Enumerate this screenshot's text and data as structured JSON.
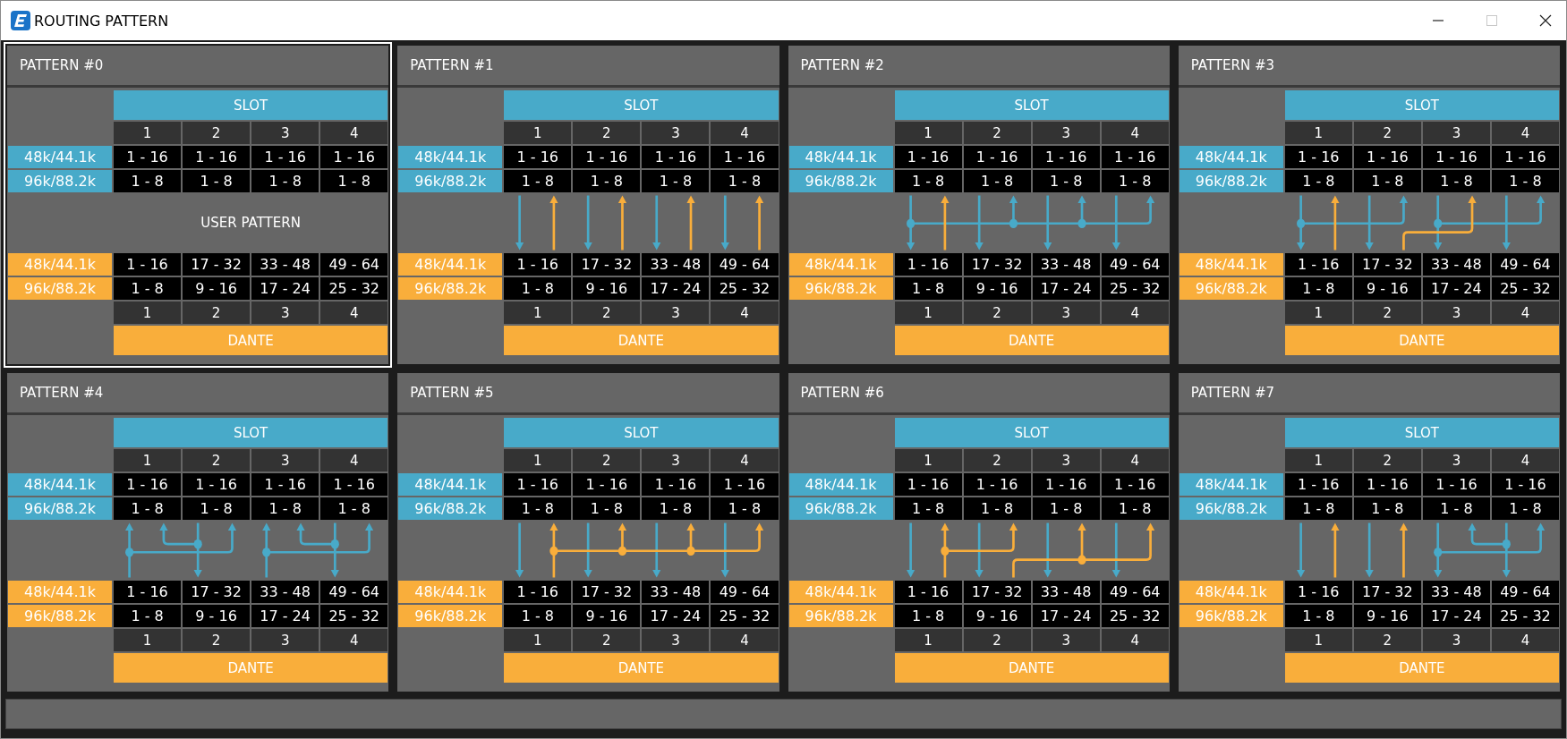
{
  "window": {
    "title": "ROUTING PATTERN",
    "controls": [
      {
        "kind": "minimize",
        "disabled": false
      },
      {
        "kind": "maximize",
        "disabled": true
      },
      {
        "kind": "close",
        "disabled": false
      }
    ]
  },
  "patterns": [
    {
      "title": "PATTERN #0",
      "selected": true,
      "slot": {
        "label": "SLOT",
        "numbers": [
          "1",
          "2",
          "3",
          "4"
        ],
        "rates": [
          {
            "label": "48k/44.1k",
            "ranges": [
              "1 - 16",
              "1 - 16",
              "1 - 16",
              "1 - 16"
            ]
          },
          {
            "label": "96k/88.2k",
            "ranges": [
              "1 - 8",
              "1 - 8",
              "1 - 8",
              "1 - 8"
            ]
          }
        ]
      },
      "user_pattern": "USER PATTERN",
      "dante": {
        "rates": [
          {
            "label": "48k/44.1k",
            "ranges": [
              "1 - 16",
              "17 - 32",
              "33 - 48",
              "49 - 64"
            ]
          },
          {
            "label": "96k/88.2k",
            "ranges": [
              "1 - 8",
              "9 - 16",
              "17 - 24",
              "25 - 32"
            ]
          }
        ],
        "numbers": [
          "1",
          "2",
          "3",
          "4"
        ],
        "label": "DANTE"
      }
    },
    {
      "title": "PATTERN #1",
      "selected": false,
      "slot": {
        "label": "SLOT",
        "numbers": [
          "1",
          "2",
          "3",
          "4"
        ],
        "rates": [
          {
            "label": "48k/44.1k",
            "ranges": [
              "1 - 16",
              "1 - 16",
              "1 - 16",
              "1 - 16"
            ]
          },
          {
            "label": "96k/88.2k",
            "ranges": [
              "1 - 8",
              "1 - 8",
              "1 - 8",
              "1 - 8"
            ]
          }
        ]
      },
      "dante": {
        "rates": [
          {
            "label": "48k/44.1k",
            "ranges": [
              "1 - 16",
              "17 - 32",
              "33 - 48",
              "49 - 64"
            ]
          },
          {
            "label": "96k/88.2k",
            "ranges": [
              "1 - 8",
              "9 - 16",
              "17 - 24",
              "25 - 32"
            ]
          }
        ],
        "numbers": [
          "1",
          "2",
          "3",
          "4"
        ],
        "label": "DANTE"
      }
    },
    {
      "title": "PATTERN #2",
      "selected": false,
      "slot": {
        "label": "SLOT",
        "numbers": [
          "1",
          "2",
          "3",
          "4"
        ],
        "rates": [
          {
            "label": "48k/44.1k",
            "ranges": [
              "1 - 16",
              "1 - 16",
              "1 - 16",
              "1 - 16"
            ]
          },
          {
            "label": "96k/88.2k",
            "ranges": [
              "1 - 8",
              "1 - 8",
              "1 - 8",
              "1 - 8"
            ]
          }
        ]
      },
      "dante": {
        "rates": [
          {
            "label": "48k/44.1k",
            "ranges": [
              "1 - 16",
              "17 - 32",
              "33 - 48",
              "49 - 64"
            ]
          },
          {
            "label": "96k/88.2k",
            "ranges": [
              "1 - 8",
              "9 - 16",
              "17 - 24",
              "25 - 32"
            ]
          }
        ],
        "numbers": [
          "1",
          "2",
          "3",
          "4"
        ],
        "label": "DANTE"
      }
    },
    {
      "title": "PATTERN #3",
      "selected": false,
      "slot": {
        "label": "SLOT",
        "numbers": [
          "1",
          "2",
          "3",
          "4"
        ],
        "rates": [
          {
            "label": "48k/44.1k",
            "ranges": [
              "1 - 16",
              "1 - 16",
              "1 - 16",
              "1 - 16"
            ]
          },
          {
            "label": "96k/88.2k",
            "ranges": [
              "1 - 8",
              "1 - 8",
              "1 - 8",
              "1 - 8"
            ]
          }
        ]
      },
      "dante": {
        "rates": [
          {
            "label": "48k/44.1k",
            "ranges": [
              "1 - 16",
              "17 - 32",
              "33 - 48",
              "49 - 64"
            ]
          },
          {
            "label": "96k/88.2k",
            "ranges": [
              "1 - 8",
              "9 - 16",
              "17 - 24",
              "25 - 32"
            ]
          }
        ],
        "numbers": [
          "1",
          "2",
          "3",
          "4"
        ],
        "label": "DANTE"
      }
    },
    {
      "title": "PATTERN #4",
      "selected": false,
      "slot": {
        "label": "SLOT",
        "numbers": [
          "1",
          "2",
          "3",
          "4"
        ],
        "rates": [
          {
            "label": "48k/44.1k",
            "ranges": [
              "1 - 16",
              "1 - 16",
              "1 - 16",
              "1 - 16"
            ]
          },
          {
            "label": "96k/88.2k",
            "ranges": [
              "1 - 8",
              "1 - 8",
              "1 - 8",
              "1 - 8"
            ]
          }
        ]
      },
      "dante": {
        "rates": [
          {
            "label": "48k/44.1k",
            "ranges": [
              "1 - 16",
              "17 - 32",
              "33 - 48",
              "49 - 64"
            ]
          },
          {
            "label": "96k/88.2k",
            "ranges": [
              "1 - 8",
              "9 - 16",
              "17 - 24",
              "25 - 32"
            ]
          }
        ],
        "numbers": [
          "1",
          "2",
          "3",
          "4"
        ],
        "label": "DANTE"
      }
    },
    {
      "title": "PATTERN #5",
      "selected": false,
      "slot": {
        "label": "SLOT",
        "numbers": [
          "1",
          "2",
          "3",
          "4"
        ],
        "rates": [
          {
            "label": "48k/44.1k",
            "ranges": [
              "1 - 16",
              "1 - 16",
              "1 - 16",
              "1 - 16"
            ]
          },
          {
            "label": "96k/88.2k",
            "ranges": [
              "1 - 8",
              "1 - 8",
              "1 - 8",
              "1 - 8"
            ]
          }
        ]
      },
      "dante": {
        "rates": [
          {
            "label": "48k/44.1k",
            "ranges": [
              "1 - 16",
              "17 - 32",
              "33 - 48",
              "49 - 64"
            ]
          },
          {
            "label": "96k/88.2k",
            "ranges": [
              "1 - 8",
              "9 - 16",
              "17 - 24",
              "25 - 32"
            ]
          }
        ],
        "numbers": [
          "1",
          "2",
          "3",
          "4"
        ],
        "label": "DANTE"
      }
    },
    {
      "title": "PATTERN #6",
      "selected": false,
      "slot": {
        "label": "SLOT",
        "numbers": [
          "1",
          "2",
          "3",
          "4"
        ],
        "rates": [
          {
            "label": "48k/44.1k",
            "ranges": [
              "1 - 16",
              "1 - 16",
              "1 - 16",
              "1 - 16"
            ]
          },
          {
            "label": "96k/88.2k",
            "ranges": [
              "1 - 8",
              "1 - 8",
              "1 - 8",
              "1 - 8"
            ]
          }
        ]
      },
      "dante": {
        "rates": [
          {
            "label": "48k/44.1k",
            "ranges": [
              "1 - 16",
              "17 - 32",
              "33 - 48",
              "49 - 64"
            ]
          },
          {
            "label": "96k/88.2k",
            "ranges": [
              "1 - 8",
              "9 - 16",
              "17 - 24",
              "25 - 32"
            ]
          }
        ],
        "numbers": [
          "1",
          "2",
          "3",
          "4"
        ],
        "label": "DANTE"
      }
    },
    {
      "title": "PATTERN #7",
      "selected": false,
      "slot": {
        "label": "SLOT",
        "numbers": [
          "1",
          "2",
          "3",
          "4"
        ],
        "rates": [
          {
            "label": "48k/44.1k",
            "ranges": [
              "1 - 16",
              "1 - 16",
              "1 - 16",
              "1 - 16"
            ]
          },
          {
            "label": "96k/88.2k",
            "ranges": [
              "1 - 8",
              "1 - 8",
              "1 - 8",
              "1 - 8"
            ]
          }
        ]
      },
      "dante": {
        "rates": [
          {
            "label": "48k/44.1k",
            "ranges": [
              "1 - 16",
              "17 - 32",
              "33 - 48",
              "49 - 64"
            ]
          },
          {
            "label": "96k/88.2k",
            "ranges": [
              "1 - 8",
              "9 - 16",
              "17 - 24",
              "25 - 32"
            ]
          }
        ],
        "numbers": [
          "1",
          "2",
          "3",
          "4"
        ],
        "label": "DANTE"
      }
    }
  ]
}
